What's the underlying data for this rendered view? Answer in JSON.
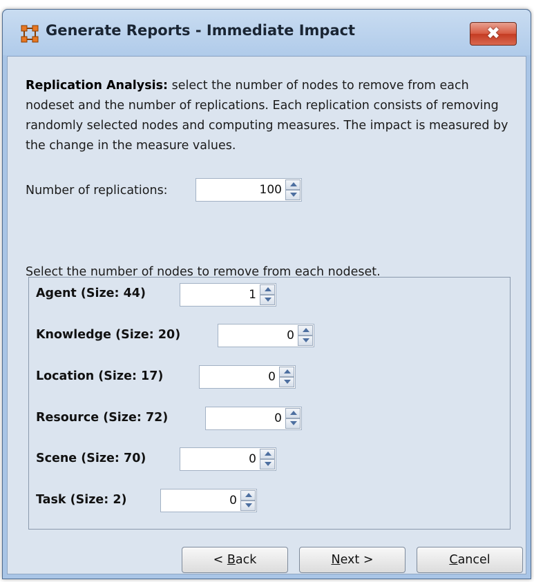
{
  "window": {
    "title": "Generate Reports - Immediate Impact",
    "close_symbol": "✖"
  },
  "description": {
    "bold": "Replication Analysis:",
    "text": " select the number of nodes to remove from each nodeset and the number of replications. Each replication consists of removing randomly selected nodes and computing measures. The impact is measured by the change in the measure values."
  },
  "replications": {
    "label": "Number of replications:",
    "value": "100"
  },
  "nodes": {
    "label": "Select the number of nodes to remove from each nodeset.",
    "items": [
      {
        "label": "Agent (Size: 44)",
        "value": "1"
      },
      {
        "label": "Knowledge (Size: 20)",
        "value": "0"
      },
      {
        "label": "Location (Size: 17)",
        "value": "0"
      },
      {
        "label": "Resource (Size: 72)",
        "value": "0"
      },
      {
        "label": "Scene (Size: 70)",
        "value": "0"
      },
      {
        "label": "Task (Size: 2)",
        "value": "0"
      }
    ]
  },
  "buttons": {
    "back_prefix": "< ",
    "back_mnemonic": "B",
    "back_rest": "ack",
    "next_mnemonic": "N",
    "next_rest": "ext >",
    "cancel_mnemonic": "C",
    "cancel_rest": "ancel"
  },
  "icons": {
    "app": "network-grid-icon",
    "close": "close-icon",
    "spin_up": "arrow-up-icon",
    "spin_down": "arrow-down-icon"
  },
  "colors": {
    "title_bar": "#b0cbea",
    "close_button": "#c43b22",
    "app_icon": "#e87722",
    "content_bg": "#dbe4ef"
  }
}
